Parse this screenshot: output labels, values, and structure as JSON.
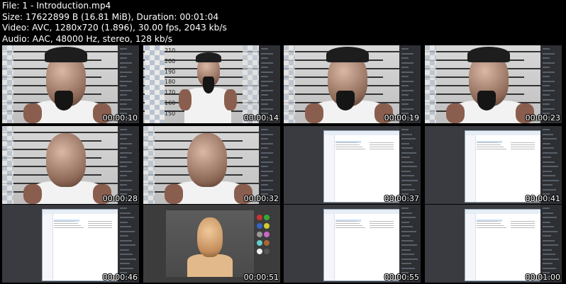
{
  "header": {
    "line1": "File: 1 - Introduction.mp4",
    "line2": "Size: 17622899 B (16.81 MiB), Duration: 00:01:04",
    "line3": "Video: AVC, 1280x720 (1.896), 30.00 fps, 2043 kb/s",
    "line4": "Audio: AAC, 48000 Hz, stereo, 128 kb/s"
  },
  "thumbnails": [
    {
      "timestamp": "00:00:10",
      "scene": "face-bandana"
    },
    {
      "timestamp": "00:00:14",
      "scene": "face-bust"
    },
    {
      "timestamp": "00:00:19",
      "scene": "face-bandana"
    },
    {
      "timestamp": "00:00:23",
      "scene": "face-bandana"
    },
    {
      "timestamp": "00:00:28",
      "scene": "face-bald"
    },
    {
      "timestamp": "00:00:32",
      "scene": "face-bald"
    },
    {
      "timestamp": "00:00:37",
      "scene": "explorer"
    },
    {
      "timestamp": "00:00:41",
      "scene": "explorer"
    },
    {
      "timestamp": "00:00:46",
      "scene": "explorer"
    },
    {
      "timestamp": "00:00:51",
      "scene": "sculpt"
    },
    {
      "timestamp": "00:00:55",
      "scene": "explorer"
    },
    {
      "timestamp": "00:01:00",
      "scene": "explorer"
    }
  ],
  "height_chart_labels": [
    "210",
    "200",
    "190",
    "180",
    "170",
    "160",
    "150"
  ]
}
